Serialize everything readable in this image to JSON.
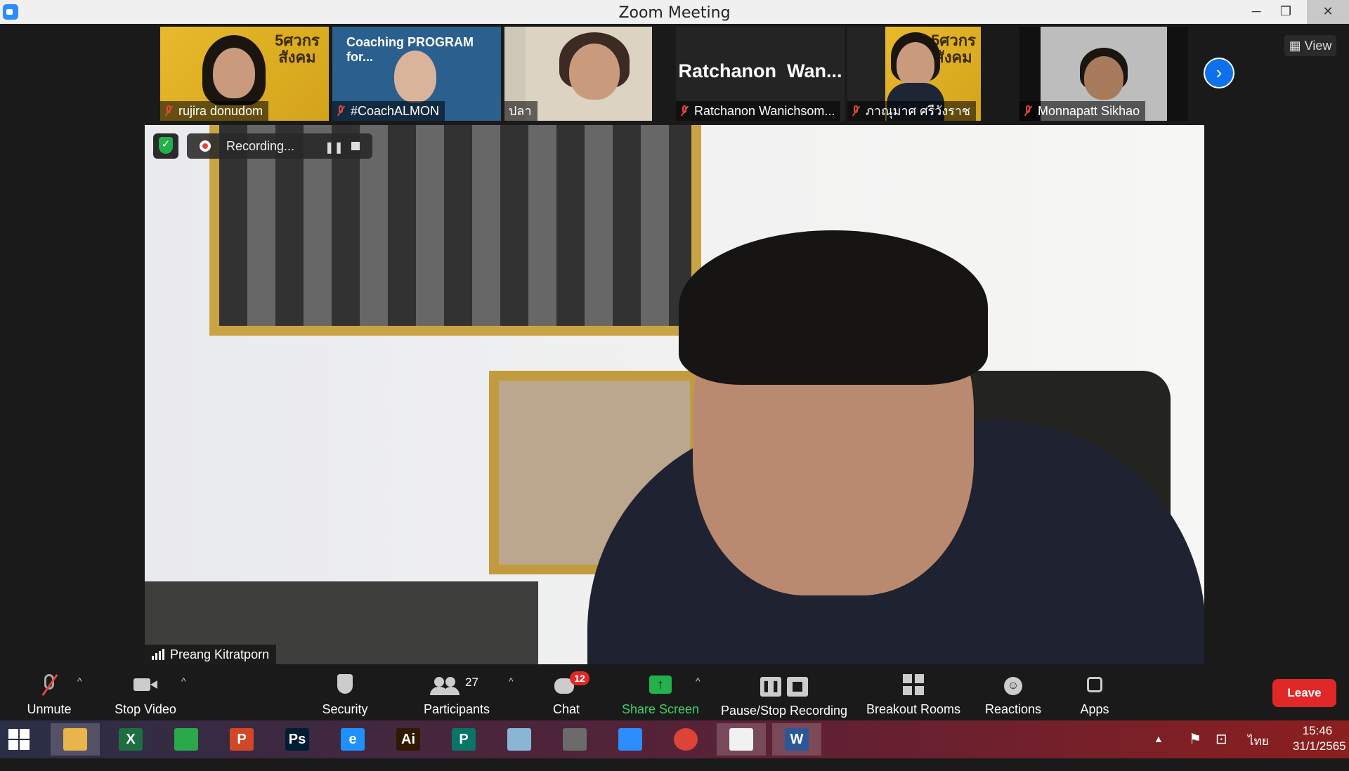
{
  "window": {
    "title": "Zoom Meeting"
  },
  "strip": {
    "tiles": [
      {
        "name": "rujira donudom",
        "poster_text": "5ศวกร\nสังคม"
      },
      {
        "name": "#CoachALMON",
        "poster_text": "Coaching PROGRAM for..."
      },
      {
        "name": "ปลา"
      },
      {
        "name": "Ratchanon Wanichsom...",
        "big_name": "Ratchanon  Wan..."
      },
      {
        "name": "ภาณุมาศ ศรีวังราช",
        "poster_text": "5ศวกร\nสังคม"
      },
      {
        "name": "Monnapatt Sikhao"
      }
    ],
    "view_label": "View"
  },
  "main": {
    "speaker_name": "Preang Kitratporn",
    "recording_label": "Recording..."
  },
  "toolbar": {
    "unmute": "Unmute",
    "stop_video": "Stop Video",
    "security": "Security",
    "participants": "Participants",
    "participants_count": "27",
    "chat": "Chat",
    "chat_badge": "12",
    "share_screen": "Share Screen",
    "recording": "Pause/Stop Recording",
    "breakout": "Breakout Rooms",
    "reactions": "Reactions",
    "apps": "Apps",
    "leave": "Leave"
  },
  "taskbar": {
    "apps": [
      {
        "label": "",
        "icon": "file-explorer-icon",
        "color": "#e8b54a"
      },
      {
        "label": "X",
        "icon": "excel-icon",
        "color": "#1d6f42"
      },
      {
        "label": "",
        "icon": "store-icon",
        "color": "#2aa84a"
      },
      {
        "label": "P",
        "icon": "powerpoint-icon",
        "color": "#d24726"
      },
      {
        "label": "Ps",
        "icon": "photoshop-icon",
        "color": "#001d34"
      },
      {
        "label": "e",
        "icon": "internet-explorer-icon",
        "color": "#1e90ff"
      },
      {
        "label": "Ai",
        "icon": "illustrator-icon",
        "color": "#2e1a00"
      },
      {
        "label": "P",
        "icon": "publisher-icon",
        "color": "#077568"
      },
      {
        "label": "",
        "icon": "app-icon",
        "color": "#8ab6d6"
      },
      {
        "label": "",
        "icon": "photoscape-icon",
        "color": "#6b6b6b"
      },
      {
        "label": "",
        "icon": "zoom-icon",
        "color": "#2d8cff"
      },
      {
        "label": "",
        "icon": "chrome-icon",
        "color": "#db4437"
      },
      {
        "label": "",
        "icon": "presentation-icon",
        "color": "#f1f1f1"
      },
      {
        "label": "W",
        "icon": "word-icon",
        "color": "#2b579a"
      }
    ],
    "language": "ไทย",
    "time": "15:46",
    "date": "31/1/2565"
  }
}
